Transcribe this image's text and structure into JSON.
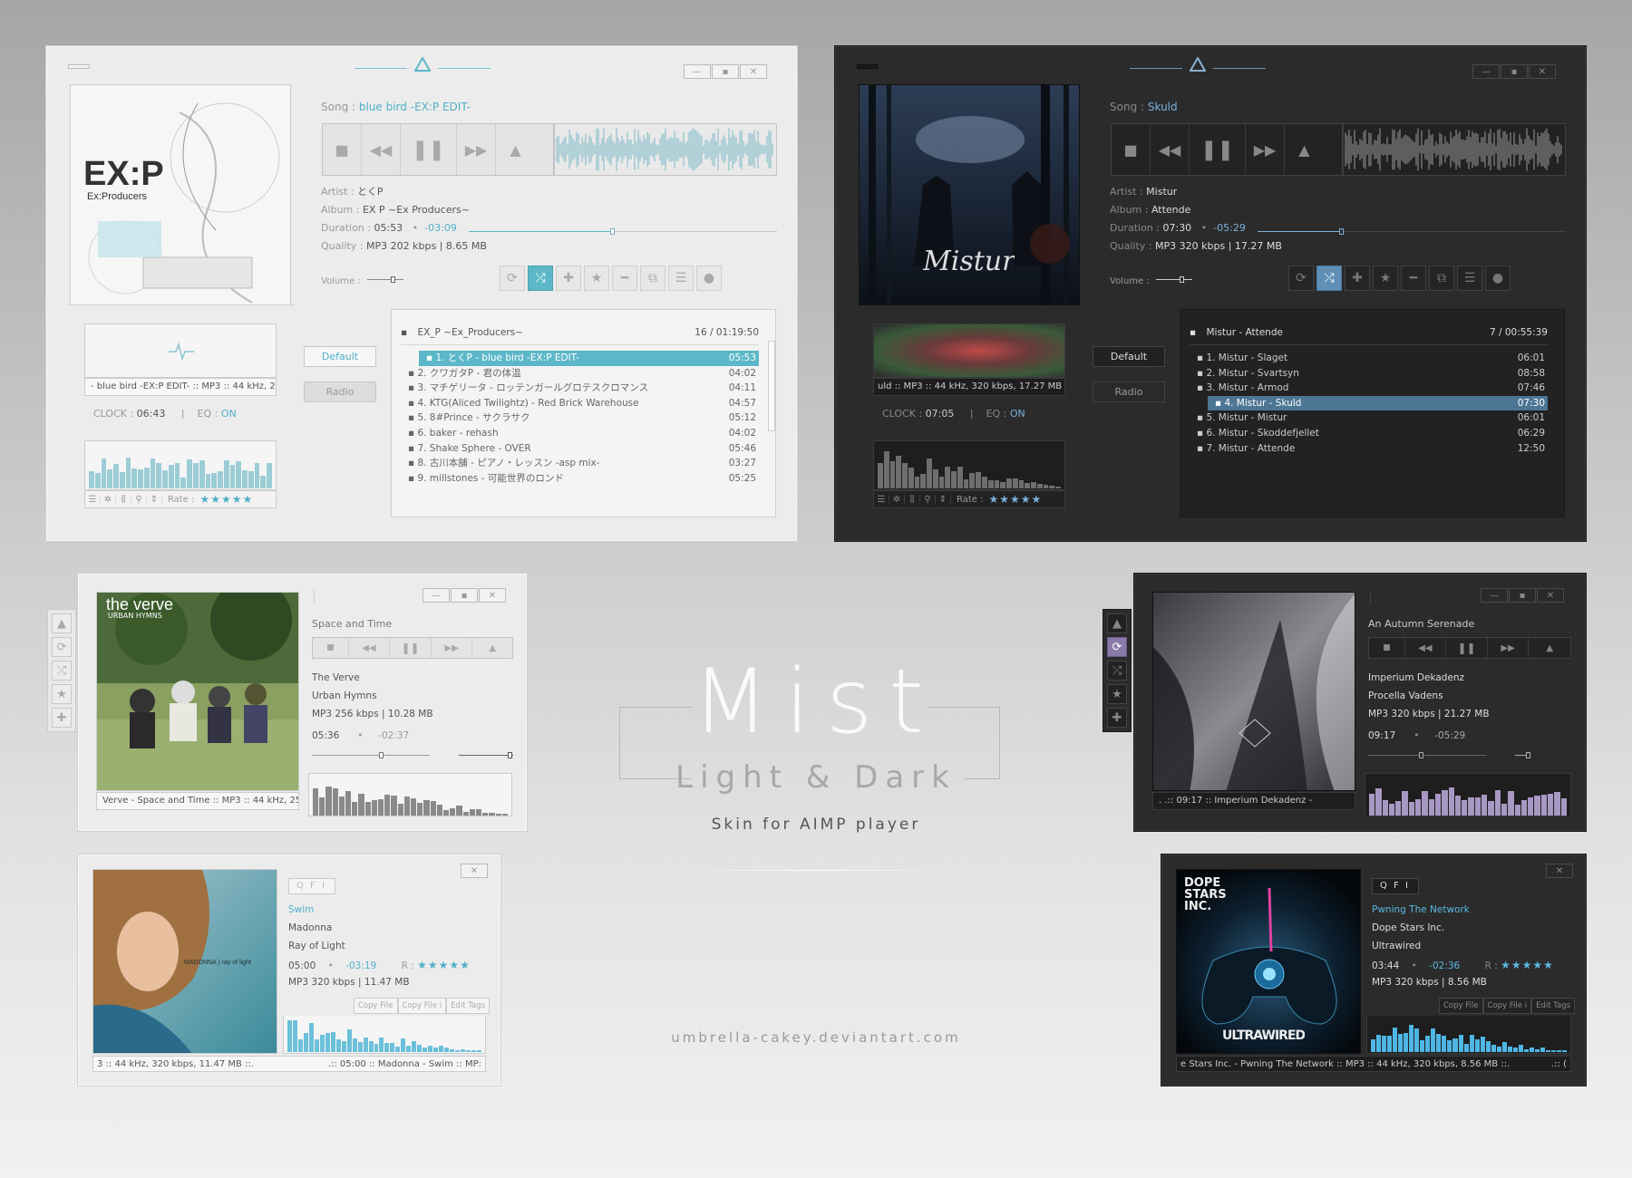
{
  "center": {
    "title": "Mist",
    "subtitle": "Light & Dark",
    "tagline": "Skin for AIMP player",
    "credit": "umbrella-cakey.deviantart.com"
  },
  "colors": {
    "accent_light": "#5cb8c8",
    "accent_dark": "#5f8fb5",
    "accent_purple": "#9a8ab5"
  },
  "win_buttons": [
    "—",
    "▪",
    "✕"
  ],
  "light_main": {
    "song_label": "Song :",
    "song": "blue bird -EX:P EDIT-",
    "artist_label": "Artist :",
    "artist": "とくP",
    "album_label": "Album :",
    "album": "EX P ~Ex Producers~",
    "duration_label": "Duration :",
    "duration": "05:53",
    "remaining": "-03:09",
    "quality_label": "Quality :",
    "quality": "MP3 202 kbps  |  8.65 MB",
    "volume_label": "Volume :",
    "default_btn": "Default",
    "radio_btn": "Radio",
    "info_line": "- blue bird -EX:P EDIT- :: MP3 :: 44 kHz, 2(",
    "clock_label": "CLOCK :",
    "clock": "06:43",
    "eq_label": "EQ :",
    "eq": "ON",
    "rate_label": "Rate :",
    "stars": "★★★★★",
    "pl_title": "EX_P ~Ex_Producers~",
    "pl_count": "16 / 01:19:50",
    "playlist": [
      {
        "title": "1. とくP - blue bird -EX:P EDIT-",
        "time": "05:53"
      },
      {
        "title": "2. クワガタP - 君の体温",
        "time": "04:02"
      },
      {
        "title": "3. マチゲリータ - ロッテンガールグロテスクロマンス",
        "time": "04:11"
      },
      {
        "title": "4. KTG(Aliced Twilightz) - Red Brick Warehouse",
        "time": "04:57"
      },
      {
        "title": "5. 8#Prince - サクラサク",
        "time": "05:12"
      },
      {
        "title": "6. baker - rehash",
        "time": "04:02"
      },
      {
        "title": "7. Shake Sphere - OVER",
        "time": "05:46"
      },
      {
        "title": "8. 古川本舗 - ピアノ・レッスン -asp mix-",
        "time": "03:27"
      },
      {
        "title": "9. millstones - 可能世界のロンド",
        "time": "05:25"
      }
    ]
  },
  "dark_main": {
    "song_label": "Song :",
    "song": "Skuld",
    "artist_label": "Artist :",
    "artist": "Mistur",
    "album_label": "Album :",
    "album": "Attende",
    "duration_label": "Duration :",
    "duration": "07:30",
    "remaining": "-05:29",
    "quality_label": "Quality :",
    "quality": "MP3 320 kbps  |  17.27 MB",
    "volume_label": "Volume :",
    "default_btn": "Default",
    "radio_btn": "Radio",
    "info_line": "uld :: MP3 :: 44 kHz, 320 kbps, 17.27 MB",
    "clock_label": "CLOCK :",
    "clock": "07:05",
    "eq_label": "EQ :",
    "eq": "ON",
    "rate_label": "Rate :",
    "stars": "★★★★★",
    "cover_text": "Mistur",
    "pl_title": "Mistur - Attende",
    "pl_count": "7 / 00:55:39",
    "playlist": [
      {
        "title": "1. Mistur - Slaget",
        "time": "06:01"
      },
      {
        "title": "2. Mistur - Svartsyn",
        "time": "08:58"
      },
      {
        "title": "3. Mistur - Armod",
        "time": "07:46"
      },
      {
        "title": "4. Mistur - Skuld",
        "time": "07:30"
      },
      {
        "title": "5. Mistur - Mistur",
        "time": "06:01"
      },
      {
        "title": "6. Mistur - Skoddefjellet",
        "time": "06:29"
      },
      {
        "title": "7. Mistur - Attende",
        "time": "12:50"
      }
    ]
  },
  "verve": {
    "song": "Space and Time",
    "artist": "The Verve",
    "album": "Urban Hymns",
    "quality": "MP3 256 kbps  |  10.28 MB",
    "duration": "05:36",
    "remaining": "-02:37",
    "info_line": "Verve - Space and Time :: MP3 :: 44 kHz, 25",
    "cover_title": "the verve",
    "cover_sub": "URBAN HYMNS"
  },
  "autumn": {
    "song": "An Autumn Serenade",
    "artist": "Imperium Dekadenz",
    "album": "Procella Vadens",
    "quality": "MP3 320 kbps  |  21.27 MB",
    "duration": "09:17",
    "remaining": "-05:29",
    "info_line": ". .:: 09:17 :: Imperium Dekadenz -"
  },
  "madonna": {
    "qfi": "Q F I",
    "song": "Swim",
    "artist": "Madonna",
    "album": "Ray of Light",
    "duration": "05:00",
    "remaining": "-03:19",
    "rate_label": "R :",
    "stars": "★★★★★",
    "quality": "MP3 320 kbps  |  11.47 MB",
    "buttons": [
      "Copy File",
      "Copy File i",
      "Edit Tags"
    ],
    "info_line": "3 :: 44 kHz, 320 kbps, 11.47 MB ::.",
    "info_line2": ".:: 05:00 :: Madonna - Swim :: MP:"
  },
  "dope": {
    "qfi": "Q F I",
    "song": "Pwning The Network",
    "artist": "Dope Stars Inc.",
    "album": "Ultrawired",
    "duration": "03:44",
    "remaining": "-02:36",
    "rate_label": "R :",
    "stars": "★★★★★",
    "quality": "MP3 320 kbps  |  8.56 MB",
    "buttons": [
      "Copy File",
      "Copy File i",
      "Edit Tags"
    ],
    "info_line": "e Stars Inc. - Pwning The Network :: MP3 :: 44 kHz, 320 kbps, 8.56 MB ::.",
    "info_line2": ".:: (",
    "cover_title": "DOPE STARS INC.",
    "cover_sub": "ULTRAWIRED"
  }
}
